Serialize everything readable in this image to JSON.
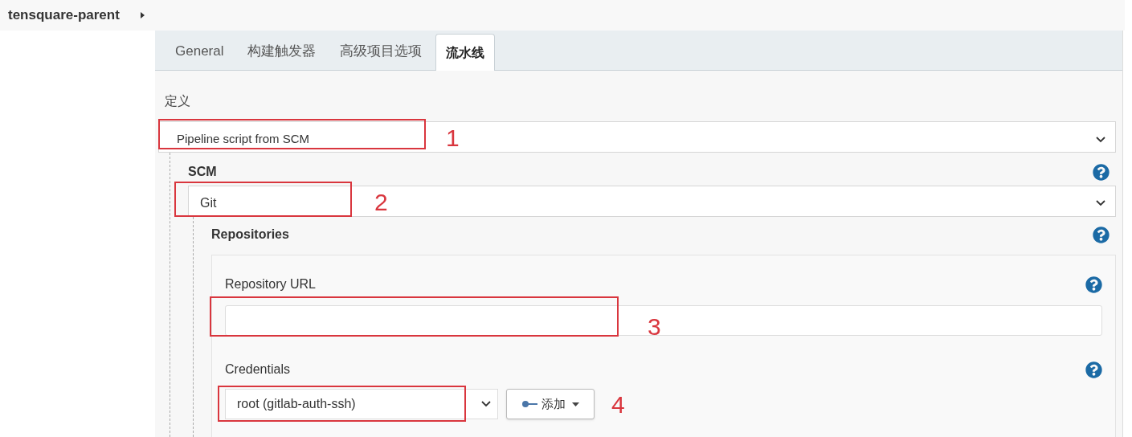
{
  "breadcrumb": {
    "title": "tensquare-parent"
  },
  "tabs": [
    {
      "label": "General",
      "selected": false
    },
    {
      "label": "构建触发器",
      "selected": false
    },
    {
      "label": "高级项目选项",
      "selected": false
    },
    {
      "label": "流水线",
      "selected": true
    }
  ],
  "definition": {
    "label": "定义",
    "value": "Pipeline script from SCM"
  },
  "scm": {
    "label": "SCM",
    "value": "Git"
  },
  "repositories": {
    "label": "Repositories",
    "url_label": "Repository URL"
  },
  "credentials": {
    "label": "Credentials",
    "value": "root (gitlab-auth-ssh)",
    "add_button": "添加"
  },
  "annotations": [
    "1",
    "2",
    "3",
    "4"
  ]
}
